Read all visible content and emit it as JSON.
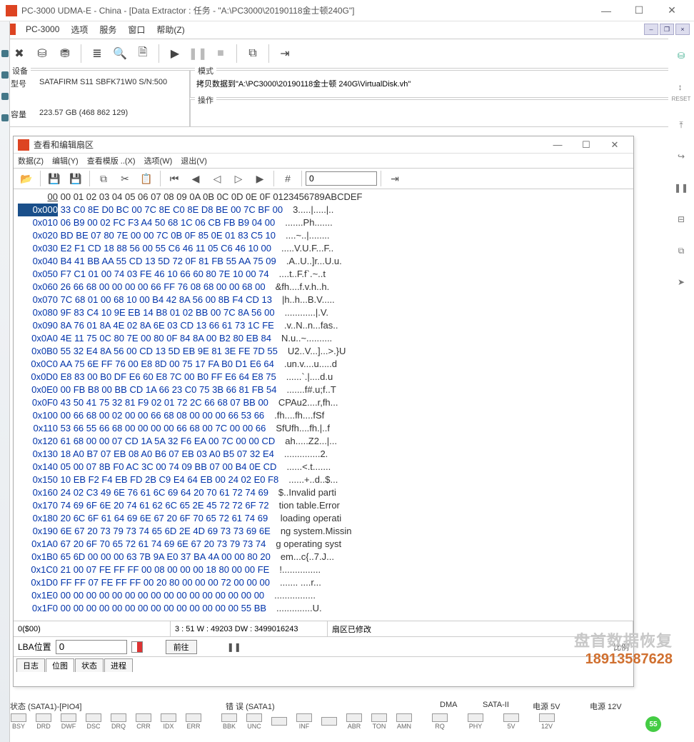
{
  "window": {
    "title": "PC-3000 UDMA-E - China - [Data Extractor : 任务 - \"A:\\PC3000\\20190118金士顿240G\"]",
    "min_glyph": "—",
    "max_glyph": "☐",
    "close_glyph": "✕"
  },
  "menubar": {
    "app": "PC-3000",
    "items": [
      "选项",
      "服务",
      "窗口",
      "帮助(Z)"
    ]
  },
  "toolbar_icons": [
    "hammer",
    "disk1",
    "disk2",
    "align",
    "binoc",
    "doc",
    "play",
    "pause",
    "stop",
    "copy",
    "exit"
  ],
  "device": {
    "legend": "设备",
    "model_l": "型号",
    "model_v": "SATAFIRM   S11 SBFK71W0 S/N:500",
    "cap_l": "容量",
    "cap_v": "223.57 GB (468 862 129)"
  },
  "mode": {
    "legend": "模式",
    "value": "拷贝数据到\"A:\\PC3000\\20190118金士顿 240G\\VirtualDisk.vh\"",
    "op_legend": "操作"
  },
  "right_strip": [
    "RESET",
    "",
    "",
    "II",
    "",
    "",
    ""
  ],
  "inner": {
    "title": "查看和编辑扇区",
    "menu": [
      "数据(Z)",
      "编辑(Y)",
      "查看模版 ..(X)",
      "选项(W)",
      "退出(V)"
    ],
    "tool_icons": [
      "open",
      "save",
      "save2",
      "copy",
      "cut",
      "paste",
      "first",
      "prev",
      "prev2",
      "next",
      "next2",
      "grid"
    ],
    "sector_input": "0",
    "header_off": "00",
    "header_cols": "00 01 02 03 04 05 06 07 08 09 0A 0B 0C 0D 0E 0F",
    "header_ascii": "0123456789ABCDEF",
    "rows": [
      {
        "off": "0x000",
        "b": "33 C0 8E D0 BC 00 7C 8E C0 8E D8 BE 00 7C BF 00",
        "a": "3.....|.....|.."
      },
      {
        "off": "0x010",
        "b": "06 B9 00 02 FC F3 A4 50 68 1C 06 CB FB B9 04 00",
        "a": ".......Ph......."
      },
      {
        "off": "0x020",
        "b": "BD BE 07 80 7E 00 00 7C 0B 0F 85 0E 01 83 C5 10",
        "a": "....~..|........"
      },
      {
        "off": "0x030",
        "b": "E2 F1 CD 18 88 56 00 55 C6 46 11 05 C6 46 10 00",
        "a": ".....V.U.F...F.."
      },
      {
        "off": "0x040",
        "b": "B4 41 BB AA 55 CD 13 5D 72 0F 81 FB 55 AA 75 09",
        "a": ".A..U..]r...U.u."
      },
      {
        "off": "0x050",
        "b": "F7 C1 01 00 74 03 FE 46 10 66 60 80 7E 10 00 74",
        "a": "....t..F.f`.~..t"
      },
      {
        "off": "0x060",
        "b": "26 66 68 00 00 00 00 66 FF 76 08 68 00 00 68 00",
        "a": "&fh....f.v.h..h."
      },
      {
        "off": "0x070",
        "b": "7C 68 01 00 68 10 00 B4 42 8A 56 00 8B F4 CD 13",
        "a": "|h..h...B.V....."
      },
      {
        "off": "0x080",
        "b": "9F 83 C4 10 9E EB 14 B8 01 02 BB 00 7C 8A 56 00",
        "a": "............|.V."
      },
      {
        "off": "0x090",
        "b": "8A 76 01 8A 4E 02 8A 6E 03 CD 13 66 61 73 1C FE",
        "a": ".v..N..n...fas.."
      },
      {
        "off": "0x0A0",
        "b": "4E 11 75 0C 80 7E 00 80 0F 84 8A 00 B2 80 EB 84",
        "a": "N.u..~.........."
      },
      {
        "off": "0x0B0",
        "b": "55 32 E4 8A 56 00 CD 13 5D EB 9E 81 3E FE 7D 55",
        "a": "U2..V...]...>.}U"
      },
      {
        "off": "0x0C0",
        "b": "AA 75 6E FF 76 00 E8 8D 00 75 17 FA B0 D1 E6 64",
        "a": ".un.v....u.....d"
      },
      {
        "off": "0x0D0",
        "b": "E8 83 00 B0 DF E6 60 E8 7C 00 B0 FF E6 64 E8 75",
        "a": "......`.|....d.u"
      },
      {
        "off": "0x0E0",
        "b": "00 FB B8 00 BB CD 1A 66 23 C0 75 3B 66 81 FB 54",
        "a": ".......f#.u;f..T"
      },
      {
        "off": "0x0F0",
        "b": "43 50 41 75 32 81 F9 02 01 72 2C 66 68 07 BB 00",
        "a": "CPAu2....r,fh..."
      },
      {
        "off": "0x100",
        "b": "00 66 68 00 02 00 00 66 68 08 00 00 00 66 53 66",
        "a": ".fh....fh....fSf"
      },
      {
        "off": "0x110",
        "b": "53 66 55 66 68 00 00 00 00 66 68 00 7C 00 00 66",
        "a": "SfUfh....fh.|..f"
      },
      {
        "off": "0x120",
        "b": "61 68 00 00 07 CD 1A 5A 32 F6 EA 00 7C 00 00 CD",
        "a": "ah.....Z2...|..."
      },
      {
        "off": "0x130",
        "b": "18 A0 B7 07 EB 08 A0 B6 07 EB 03 A0 B5 07 32 E4",
        "a": "..............2."
      },
      {
        "off": "0x140",
        "b": "05 00 07 8B F0 AC 3C 00 74 09 BB 07 00 B4 0E CD",
        "a": "......<.t......."
      },
      {
        "off": "0x150",
        "b": "10 EB F2 F4 EB FD 2B C9 E4 64 EB 00 24 02 E0 F8",
        "a": "......+..d..$..."
      },
      {
        "off": "0x160",
        "b": "24 02 C3 49 6E 76 61 6C 69 64 20 70 61 72 74 69",
        "a": "$..Invalid parti"
      },
      {
        "off": "0x170",
        "b": "74 69 6F 6E 20 74 61 62 6C 65 2E 45 72 72 6F 72",
        "a": "tion table.Error"
      },
      {
        "off": "0x180",
        "b": "20 6C 6F 61 64 69 6E 67 20 6F 70 65 72 61 74 69",
        "a": " loading operati"
      },
      {
        "off": "0x190",
        "b": "6E 67 20 73 79 73 74 65 6D 2E 4D 69 73 73 69 6E",
        "a": "ng system.Missin"
      },
      {
        "off": "0x1A0",
        "b": "67 20 6F 70 65 72 61 74 69 6E 67 20 73 79 73 74",
        "a": "g operating syst"
      },
      {
        "off": "0x1B0",
        "b": "65 6D 00 00 00 63 7B 9A E0 37 BA 4A 00 00 80 20",
        "a": "em...c{..7.J... "
      },
      {
        "off": "0x1C0",
        "b": "21 00 07 FE FF FF 00 08 00 00 00 18 80 00 00 FE",
        "a": "!..............."
      },
      {
        "off": "0x1D0",
        "b": "FF FF 07 FE FF FF 00 20 80 00 00 00 72 00 00 00",
        "a": "....... ....r..."
      },
      {
        "off": "0x1E0",
        "b": "00 00 00 00 00 00 00 00 00 00 00 00 00 00 00 00",
        "a": "................"
      },
      {
        "off": "0x1F0",
        "b": "00 00 00 00 00 00 00 00 00 00 00 00 00 00 55 BB",
        "a": "..............U."
      }
    ],
    "status_left": "0($00)",
    "status_mid": "3 : 51 W : 49203 DW : 3499016243",
    "status_right": "扇区已修改",
    "lba_label": "LBA位置",
    "lba_value": "0",
    "goto_btn": "前往",
    "tabs": [
      "日志",
      "位图",
      "状态",
      "进程"
    ]
  },
  "watermark": {
    "l1": "盘首数据恢复",
    "l2": "18913587628"
  },
  "bottom": {
    "group_state": "状态 (SATA1)-[PIO4]",
    "state_leds": [
      "BSY",
      "DRD",
      "DWF",
      "DSC",
      "DRQ",
      "CRR",
      "IDX",
      "ERR"
    ],
    "group_err": "错 误 (SATA1)",
    "err_leds": [
      "BBK",
      "UNC",
      "",
      "INF",
      "",
      "ABR",
      "TON",
      "AMN"
    ],
    "group_dma": "DMA",
    "dma_leds": [
      "RQ"
    ],
    "group_sata": "SATA-II",
    "sata_leds": [
      "PHY"
    ],
    "group_5v": "电源 5V",
    "v5_leds": [
      "5V"
    ],
    "group_12v": "电源 12V",
    "v12_leds": [
      "12V"
    ],
    "dot": "55"
  },
  "legend_example": "比例"
}
